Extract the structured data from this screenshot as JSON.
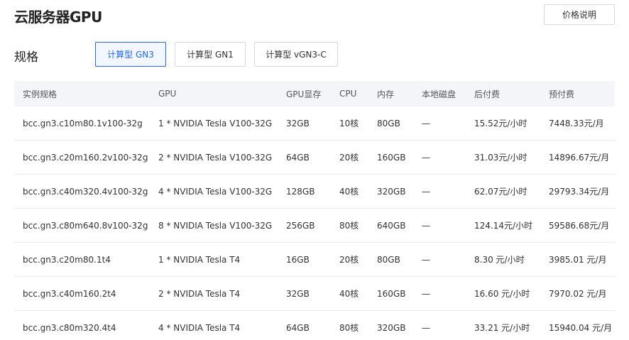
{
  "page": {
    "title": "云服务器GPU",
    "price_button": "价格说明",
    "spec_label": "规格"
  },
  "tabs": [
    {
      "label": "计算型 GN3",
      "active": true
    },
    {
      "label": "计算型 GN1",
      "active": false
    },
    {
      "label": "计算型 vGN3-C",
      "active": false
    }
  ],
  "table": {
    "headers": [
      "实例规格",
      "GPU",
      "GPU显存",
      "CPU",
      "内存",
      "本地磁盘",
      "后付费",
      "预付费"
    ],
    "rows": [
      [
        "bcc.gn3.c10m80.1v100-32g",
        "1 * NVIDIA Tesla V100-32G",
        "32GB",
        "10核",
        "80GB",
        "—",
        "15.52元/小时",
        "7448.33元/月"
      ],
      [
        "bcc.gn3.c20m160.2v100-32g",
        "2 * NVIDIA Tesla V100-32G",
        "64GB",
        "20核",
        "160GB",
        "—",
        "31.03元/小时",
        "14896.67元/月"
      ],
      [
        "bcc.gn3.c40m320.4v100-32g",
        "4 * NVIDIA Tesla V100-32G",
        "128GB",
        "40核",
        "320GB",
        "—",
        "62.07元/小时",
        "29793.34元/月"
      ],
      [
        "bcc.gn3.c80m640.8v100-32g",
        "8 * NVIDIA Tesla V100-32G",
        "256GB",
        "80核",
        "640GB",
        "—",
        "124.14元/小时",
        "59586.68元/月"
      ],
      [
        "bcc.gn3.c20m80.1t4",
        "1 * NVIDIA Tesla T4",
        "16GB",
        "20核",
        "80GB",
        "—",
        "8.30 元/小时",
        "3985.01 元/月"
      ],
      [
        "bcc.gn3.c40m160.2t4",
        "2 * NVIDIA Tesla T4",
        "32GB",
        "40核",
        "160GB",
        "—",
        "16.60 元/小时",
        "7970.02 元/月"
      ],
      [
        "bcc.gn3.c80m320.4t4",
        "4 * NVIDIA Tesla T4",
        "64GB",
        "80核",
        "320GB",
        "—",
        "33.21 元/小时",
        "15940.04 元/月"
      ]
    ]
  },
  "colors": {
    "accent": "#2468f2",
    "header_bg": "#f3f5f9"
  }
}
